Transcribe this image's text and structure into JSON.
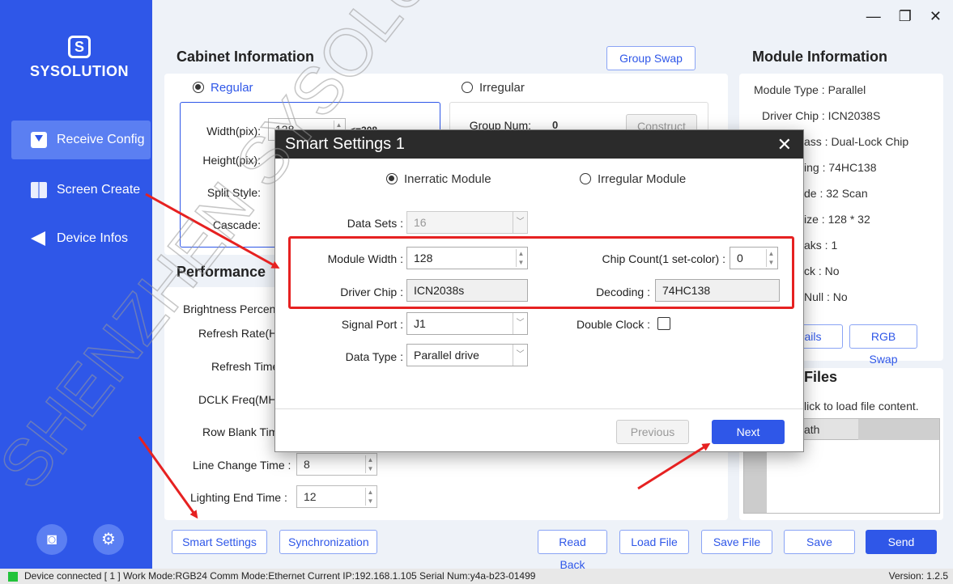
{
  "window": {
    "controls": [
      "—",
      "❐",
      "✕"
    ]
  },
  "sidebar": {
    "logo_text": "SYSOLUTION",
    "items": [
      {
        "label": "Receive Config",
        "icon": "download-icon",
        "active": true
      },
      {
        "label": "Screen Create",
        "icon": "screen-icon",
        "active": false
      },
      {
        "label": "Device Infos",
        "icon": "send-icon",
        "active": false
      }
    ]
  },
  "cabinet": {
    "title": "Cabinet Information",
    "group_swap": "Group Swap",
    "regular": "Regular",
    "irregular": "Irregular",
    "width_label": "Width(pix):",
    "width_value": "128",
    "width_max": "<=208",
    "height_label": "Height(pix):",
    "split_label": "Split Style:",
    "cascade_label": "Cascade:",
    "group_num_label": "Group Num:",
    "group_num_value": "0",
    "construct": "Construct"
  },
  "performance": {
    "title": "Performance",
    "brightness": "Brightness Percen",
    "refresh_rate": "Refresh Rate(H",
    "refresh_time": "Refresh Time",
    "dclk": "DCLK Freq(MH",
    "row_blank": "Row Blank Tim",
    "line_change_label": "Line Change Time :",
    "line_change_value": "8",
    "lighting_end_label": "Lighting End Time :",
    "lighting_end_value": "12"
  },
  "module_info": {
    "title": "Module Information",
    "rows": [
      "Module Type : Parallel",
      "Driver Chip : ICN2038S",
      "ass : Dual-Lock Chip",
      "ing : 74HC138",
      "de : 32 Scan",
      "ize : 128 * 32",
      "aks : 1",
      "ck : No",
      "Null : No"
    ],
    "details": "ails",
    "rgb_swap": "RGB Swap"
  },
  "files": {
    "title": "Files",
    "hint": "lick to load file content.",
    "col_path": "ath"
  },
  "toolbar": {
    "smart_settings": "Smart Settings",
    "synchronization": "Synchronization",
    "read_back": "Read Back",
    "load_file": "Load File",
    "save_file": "Save File",
    "save": "Save",
    "send": "Send"
  },
  "status": {
    "text": "Device connected [ 1 ] Work Mode:RGB24   Comm Mode:Ethernet   Current IP:192.168.1.105   Serial Num:y4a-b23-01499",
    "version": "Version: 1.2.5"
  },
  "dialog": {
    "title": "Smart Settings 1",
    "close": "✕",
    "option_a": "Inerratic Module",
    "option_b": "Irregular Module",
    "data_sets_label": "Data Sets :",
    "data_sets_value": "16",
    "module_width_label": "Module Width :",
    "module_width_value": "128",
    "chip_count_label": "Chip Count(1 set-color) :",
    "chip_count_value": "0",
    "driver_chip_label": "Driver Chip :",
    "driver_chip_value": "ICN2038s",
    "decoding_label": "Decoding :",
    "decoding_value": "74HC138",
    "signal_port_label": "Signal Port :",
    "signal_port_value": "J1",
    "double_clock_label": "Double Clock :",
    "data_type_label": "Data Type :",
    "data_type_value": "Parallel drive",
    "previous": "Previous",
    "next": "Next"
  },
  "watermark": "SHENZHEN SYSOLUTION",
  "colors": {
    "brand": "#2f57e8",
    "highlight": "#e62121",
    "led": "#22c33a"
  }
}
